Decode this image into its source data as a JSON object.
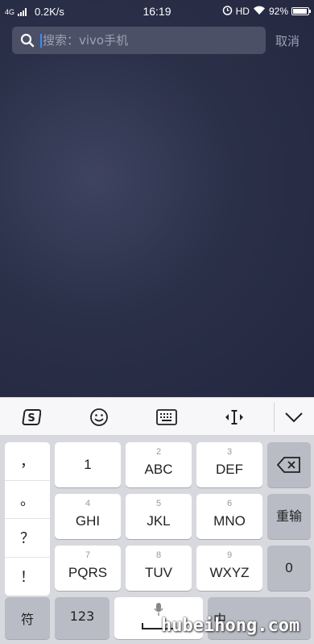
{
  "status_bar": {
    "network": "4G",
    "speed": "0.2K/s",
    "time": "16:19",
    "hd": "HD",
    "battery_percent": "92%",
    "battery_level": 0.92
  },
  "search": {
    "placeholder": "搜索：vivo手机",
    "value": "",
    "cancel_label": "取消"
  },
  "keyboard": {
    "toolbar": [
      "sogou-logo-icon",
      "emoji-icon",
      "keyboard-icon",
      "cursor-move-icon",
      "collapse-icon"
    ],
    "punctuation": [
      "，",
      "。",
      "？",
      "！"
    ],
    "keys": [
      {
        "num": "",
        "label": "1"
      },
      {
        "num": "2",
        "label": "ABC"
      },
      {
        "num": "3",
        "label": "DEF"
      },
      {
        "num": "4",
        "label": "GHI"
      },
      {
        "num": "5",
        "label": "JKL"
      },
      {
        "num": "6",
        "label": "MNO"
      },
      {
        "num": "7",
        "label": "PQRS"
      },
      {
        "num": "8",
        "label": "TUV"
      },
      {
        "num": "9",
        "label": "WXYZ"
      }
    ],
    "reenter_label": "重输",
    "zero_label": "0",
    "symbol_label": "符",
    "numbers_label": "123",
    "chinese_label": "中"
  },
  "watermark": "hubeihong.com",
  "colors": {
    "background": "#262b40",
    "search_box": "#4b5067",
    "caret": "#3b8df5",
    "keyboard_bg": "#d8d9de",
    "key_bg": "#ffffff",
    "func_key_bg": "#b9bcc5"
  }
}
